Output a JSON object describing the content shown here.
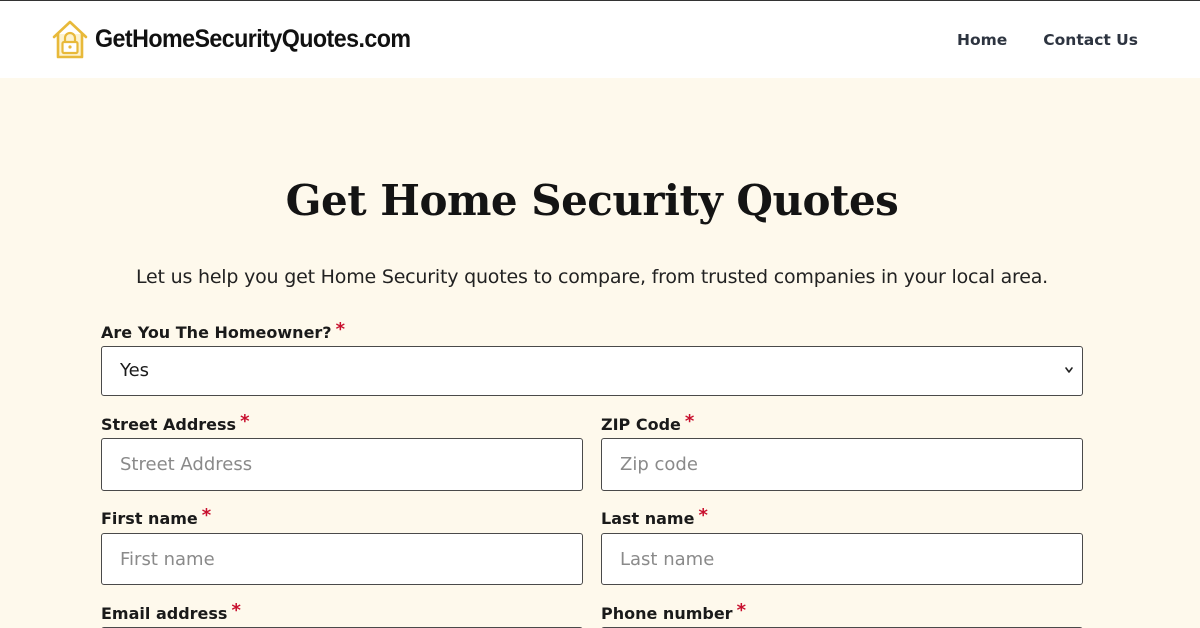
{
  "header": {
    "logo_text": "GetHomeSecurityQuotes.com",
    "logo_icon": "house-lock-icon",
    "nav": [
      {
        "label": "Home"
      },
      {
        "label": "Contact Us"
      }
    ]
  },
  "main": {
    "title": "Get Home Security Quotes",
    "subtitle": "Let us help you get Home Security quotes to compare, from trusted companies in your local area."
  },
  "form": {
    "required_mark": "*",
    "homeowner": {
      "label": "Are You The Homeowner?",
      "value": "Yes"
    },
    "street": {
      "label": "Street Address",
      "placeholder": "Street Address",
      "value": ""
    },
    "zip": {
      "label": "ZIP Code",
      "placeholder": "Zip code",
      "value": ""
    },
    "first_name": {
      "label": "First name",
      "placeholder": "First name",
      "value": ""
    },
    "last_name": {
      "label": "Last name",
      "placeholder": "Last name",
      "value": ""
    },
    "email": {
      "label": "Email address"
    },
    "phone": {
      "label": "Phone number"
    }
  },
  "colors": {
    "background": "#fef9ec",
    "header": "#ffffff",
    "required": "#c8102e",
    "logo_accent": "#e8b93a"
  }
}
